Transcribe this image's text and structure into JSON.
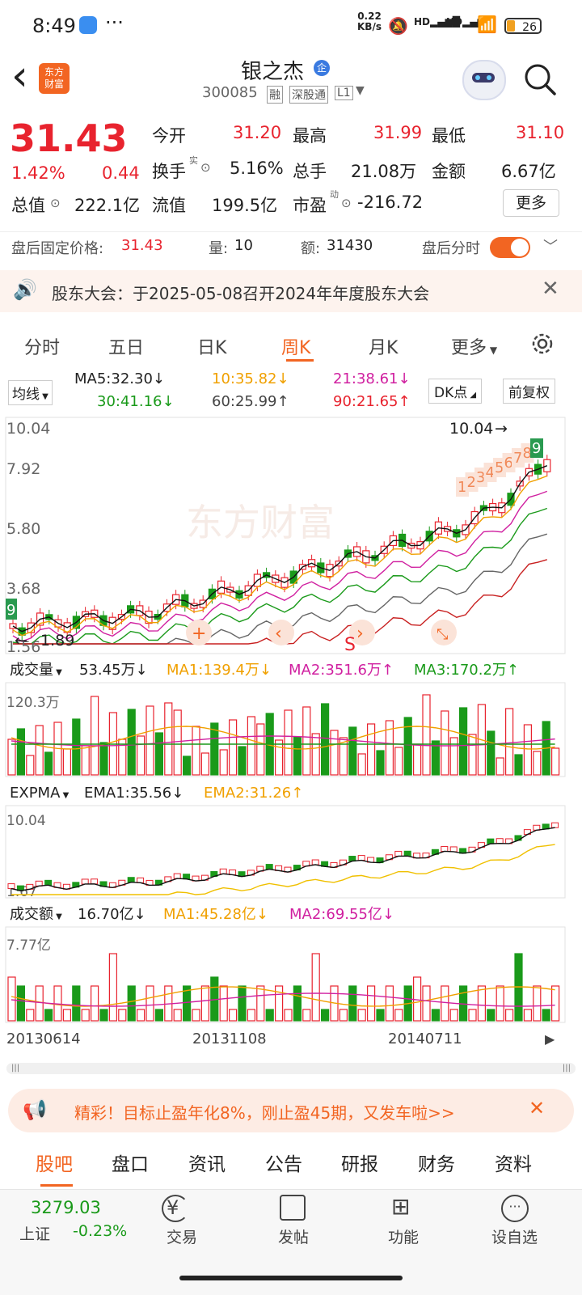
{
  "statusbar": {
    "time": "8:49",
    "dots": "···",
    "speed": "0.22",
    "speed_unit": "KB/s",
    "battery": "26"
  },
  "header": {
    "back": "‹",
    "logo_line1": "东方",
    "logo_line2": "财富",
    "title": "银之杰",
    "badge": "企",
    "code": "300085",
    "tags": [
      "融",
      "深股通",
      "L1"
    ]
  },
  "quote": {
    "price": "31.43",
    "change_pct": "1.42%",
    "change": "0.44",
    "open_label": "今开",
    "open": "31.20",
    "high_label": "最高",
    "high": "31.99",
    "low_label": "最低",
    "low": "31.10",
    "turnover_label": "换手",
    "turnover_sup": "实",
    "turnover": "5.16%",
    "volume_label": "总手",
    "volume": "21.08万",
    "amount_label": "金额",
    "amount": "6.67亿",
    "total_value_label": "总值",
    "total_value": "222.1亿",
    "float_value_label": "流值",
    "float_value": "199.5亿",
    "pe_label": "市盈",
    "pe_sup": "动",
    "pe": "-216.72",
    "more": "更多"
  },
  "afterhours": {
    "price_label": "盘后固定价格:",
    "price": "31.43",
    "qty_label": "量:",
    "qty": "10",
    "amt_label": "额:",
    "amt": "31430",
    "toggle_label": "盘后分时"
  },
  "notice": {
    "text": "股东大会：于2025-05-08召开2024年年度股东大会"
  },
  "tabs": [
    "分时",
    "五日",
    "日K",
    "周K",
    "月K",
    "更多"
  ],
  "active_tab": "周K",
  "ma": {
    "selector": "均线",
    "ma5": "MA5:32.30↓",
    "ma10": "10:35.82↓",
    "ma21": "21:38.61↓",
    "ma30": "30:41.16↓",
    "ma60": "60:25.99↑",
    "ma90": "90:21.65↑",
    "dk": "DK点",
    "adjust": "前复权"
  },
  "kchart": {
    "y_labels": [
      "10.04",
      "7.92",
      "5.80",
      "3.68",
      "1.56"
    ],
    "max_label": "10.04",
    "min_label": "1.89",
    "watermark": "东方财富",
    "signals": [
      "1",
      "2",
      "3",
      "4",
      "5",
      "6",
      "7",
      "8",
      "9"
    ],
    "left_signal": "9",
    "s_marker": "S"
  },
  "volume": {
    "selector": "成交量",
    "value": "53.45万↓",
    "ma1": "MA1:139.4万↓",
    "ma2": "MA2:351.6万↑",
    "ma3": "MA3:170.2万↑",
    "max_label": "120.3万"
  },
  "expma": {
    "selector": "EXPMA",
    "ema1": "EMA1:35.56↓",
    "ema2": "EMA2:31.26↑",
    "max_label": "10.04",
    "min_label": "1.67"
  },
  "amount": {
    "selector": "成交额",
    "value": "16.70亿↓",
    "ma1": "MA1:45.28亿↓",
    "ma2": "MA2:69.55亿↓",
    "max_label": "7.77亿"
  },
  "dates": [
    "20130614",
    "20131108",
    "20140711"
  ],
  "promo": {
    "text": "精彩！目标止盈年化8%，刚止盈45期，又发车啦>>"
  },
  "bottom_tabs": [
    "股吧",
    "盘口",
    "资讯",
    "公告",
    "研报",
    "财务",
    "资料"
  ],
  "active_bottom_tab": "股吧",
  "footer": {
    "index_value": "3279.03",
    "index_name": "上证",
    "index_change": "-0.23%",
    "trade": "交易",
    "post": "发帖",
    "func": "功能",
    "watchlist": "设自选"
  },
  "colors": {
    "up": "#e8232e",
    "down": "#1a9a1a",
    "accent": "#f26522",
    "ma_orange": "#f0a000",
    "ma_magenta": "#d020a0"
  }
}
